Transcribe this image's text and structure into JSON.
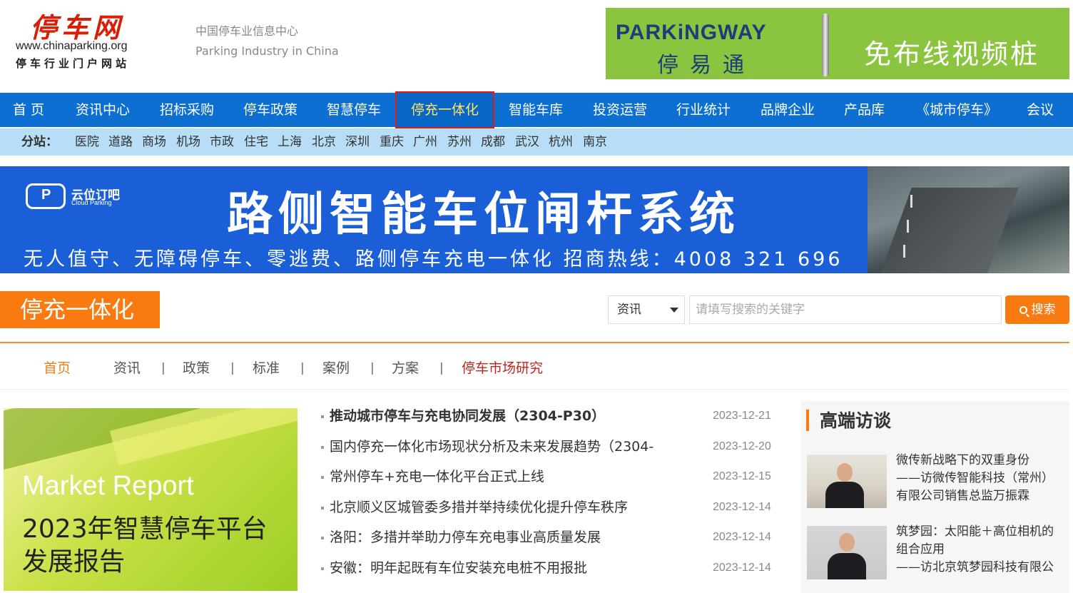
{
  "header": {
    "logo_title": "停车网",
    "logo_url": "www.chinaparking.org",
    "logo_sub": "停车行业门户网站",
    "tagline_cn": "中国停车业信息中心",
    "tagline_en": "Parking Industry in China",
    "ad": {
      "brand_en": "PARKiNGWAY",
      "brand_cn": "停易通",
      "slogan": "免布线视频桩"
    }
  },
  "nav": {
    "items": [
      {
        "label": "首 页"
      },
      {
        "label": "资讯中心"
      },
      {
        "label": "招标采购"
      },
      {
        "label": "停车政策"
      },
      {
        "label": "智慧停车"
      },
      {
        "label": "停充一体化",
        "active": true
      },
      {
        "label": "智能车库"
      },
      {
        "label": "投资运营"
      },
      {
        "label": "行业统计"
      },
      {
        "label": "品牌企业"
      },
      {
        "label": "产品库"
      },
      {
        "label": "《城市停车》"
      },
      {
        "label": "会议"
      }
    ]
  },
  "subnav": {
    "label": "分站：",
    "items": [
      "医院",
      "道路",
      "商场",
      "机场",
      "市政",
      "住宅",
      "上海",
      "北京",
      "深圳",
      "重庆",
      "广州",
      "苏州",
      "成都",
      "武汉",
      "杭州",
      "南京"
    ]
  },
  "banner": {
    "brand_cn": "云位订吧",
    "brand_en": "Cloud Parking",
    "headline": "路侧智能车位闸杆系统",
    "sub": "无人值守、无障碍停车、零逃费、路侧停车充电一体化  招商热线：4008 321 696"
  },
  "section": {
    "title": "停充一体化"
  },
  "search": {
    "select_value": "资讯",
    "placeholder": "请填写搜索的关键字",
    "button_label": "搜索"
  },
  "tabs": {
    "items": [
      "首页",
      "资讯",
      "政策",
      "标准",
      "案例",
      "方案",
      "停车市场研究"
    ],
    "separator": "|"
  },
  "feature": {
    "line1": "Market Report",
    "line2": "2023年智慧停车平台",
    "line3": "发展报告"
  },
  "news": [
    {
      "title": "推动城市停车与充电协同发展（2304-P30）",
      "date": "2023-12-21",
      "bold": true
    },
    {
      "title": "国内停充一体化市场现状分析及未来发展趋势（2304-",
      "date": "2023-12-20"
    },
    {
      "title": "常州停车+充电一体化平台正式上线",
      "date": "2023-12-15"
    },
    {
      "title": "北京顺义区城管委多措并举持续优化提升停车秩序",
      "date": "2023-12-14"
    },
    {
      "title": "洛阳：多措并举助力停车充电事业高质量发展",
      "date": "2023-12-14"
    },
    {
      "title": "安徽：明年起既有车位安装充电桩不用报批",
      "date": "2023-12-14"
    }
  ],
  "sidebar": {
    "title": "高端访谈",
    "interviews": [
      {
        "line1": "微传新战略下的双重身份",
        "line2": "——访微传智能科技（常州）",
        "line3": "有限公司销售总监万振霖"
      },
      {
        "line1": "筑梦园：太阳能＋高位相机的",
        "line2": "组合应用",
        "line3": "——访北京筑梦园科技有限公"
      }
    ]
  },
  "colors": {
    "nav_blue": "#0d6fd2",
    "subnav_blue": "#b8ddf7",
    "accent_orange": "#fa7a12",
    "active_border": "#e21a1a",
    "red_text": "#c0261e"
  }
}
